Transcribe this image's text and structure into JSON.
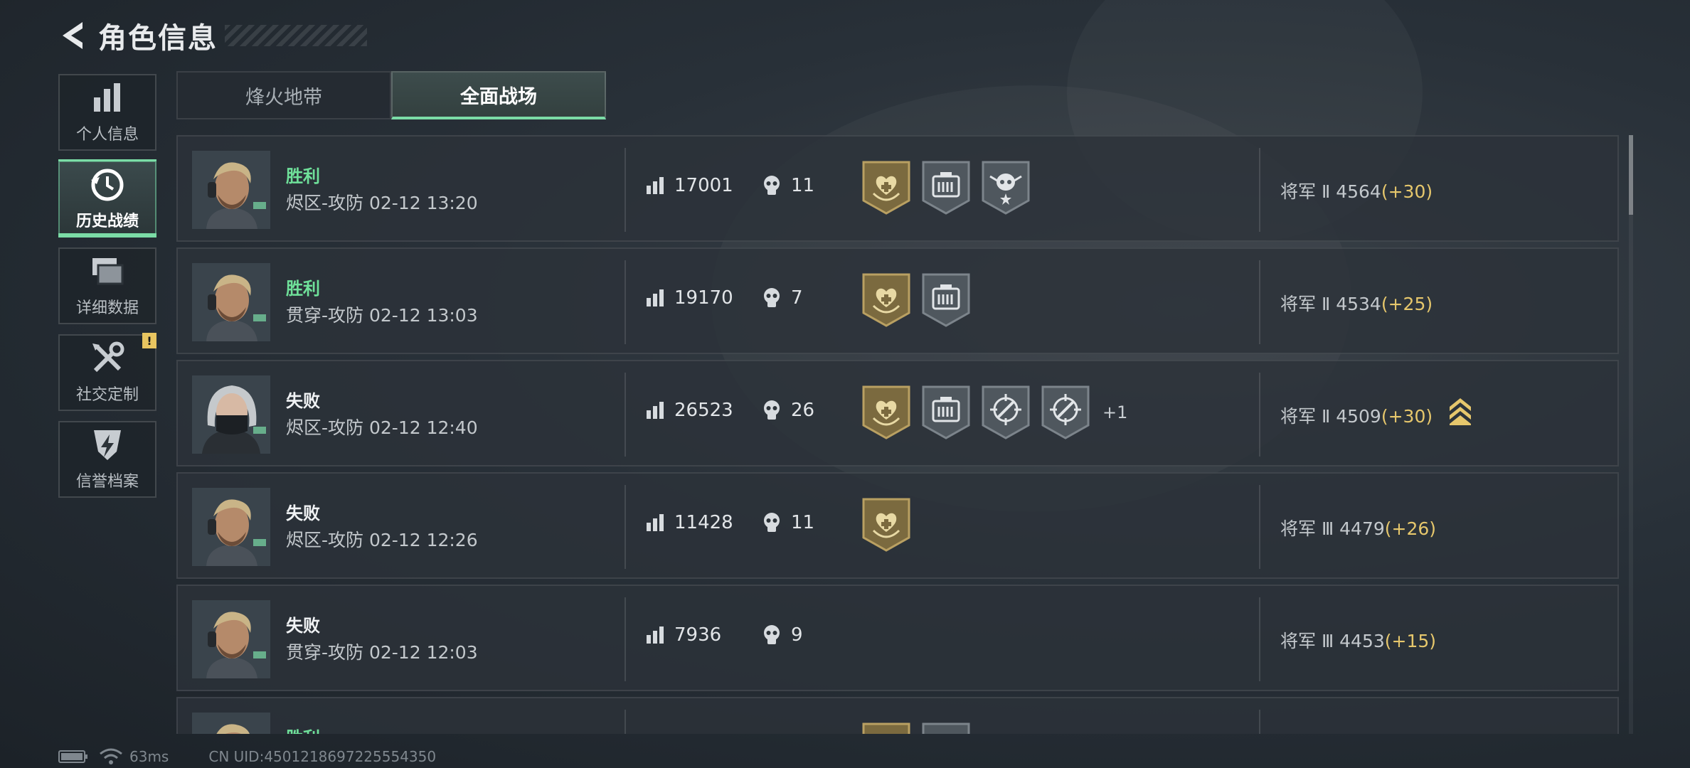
{
  "header": {
    "title": "角色信息"
  },
  "sidebar": {
    "items": [
      {
        "label": "个人信息",
        "icon": "bar-chart-icon",
        "active": false
      },
      {
        "label": "历史战绩",
        "icon": "history-clock-icon",
        "active": true
      },
      {
        "label": "详细数据",
        "icon": "cards-icon",
        "active": false
      },
      {
        "label": "社交定制",
        "icon": "tools-icon",
        "active": false,
        "badge": "!"
      },
      {
        "label": "信誉档案",
        "icon": "shield-bolt-icon",
        "active": false
      }
    ]
  },
  "tabs": [
    {
      "label": "烽火地带",
      "active": false
    },
    {
      "label": "全面战场",
      "active": true
    }
  ],
  "matches": [
    {
      "result": "胜利",
      "outcome": "win",
      "mode": "烬区-攻防",
      "time": "02-12 13:20",
      "score": "17001",
      "kills": "11",
      "badges": [
        "medic-gold",
        "supply-gray",
        "skull-gray"
      ],
      "more": "",
      "rank": "将军 Ⅱ",
      "points": "4564",
      "gain": "(+30)",
      "avatar": "male"
    },
    {
      "result": "胜利",
      "outcome": "win",
      "mode": "贯穿-攻防",
      "time": "02-12 13:03",
      "score": "19170",
      "kills": "7",
      "badges": [
        "medic-gold",
        "supply-gray"
      ],
      "more": "",
      "rank": "将军 Ⅱ",
      "points": "4534",
      "gain": "(+25)",
      "avatar": "male"
    },
    {
      "result": "失败",
      "outcome": "lose",
      "mode": "烬区-攻防",
      "time": "02-12 12:40",
      "score": "26523",
      "kills": "26",
      "badges": [
        "medic-gold",
        "supply-gray",
        "target-gray",
        "target-gray"
      ],
      "more": "+1",
      "rank": "将军 Ⅱ",
      "points": "4509",
      "gain": "(+30)",
      "avatar": "female",
      "rank_icon": true
    },
    {
      "result": "失败",
      "outcome": "lose",
      "mode": "烬区-攻防",
      "time": "02-12 12:26",
      "score": "11428",
      "kills": "11",
      "badges": [
        "medic-gold"
      ],
      "more": "",
      "rank": "将军 Ⅲ",
      "points": "4479",
      "gain": "(+26)",
      "avatar": "male"
    },
    {
      "result": "失败",
      "outcome": "lose",
      "mode": "贯穿-攻防",
      "time": "02-12 12:03",
      "score": "7936",
      "kills": "9",
      "badges": [],
      "more": "",
      "rank": "将军 Ⅲ",
      "points": "4453",
      "gain": "(+15)",
      "avatar": "male"
    },
    {
      "result": "胜利",
      "outcome": "win",
      "mode": "",
      "time": "",
      "score": "",
      "kills": "",
      "badges": [
        "medic-gold",
        "supply-gray"
      ],
      "more": "",
      "rank": "",
      "points": "",
      "gain": "",
      "avatar": "male"
    }
  ],
  "status": {
    "ping": "63ms",
    "uid": "CN UID:4501218697225554350"
  },
  "colors": {
    "accent": "#7bdca6",
    "win": "#6fe19a",
    "gain": "#e6c76c",
    "gold": "#b9a062"
  }
}
